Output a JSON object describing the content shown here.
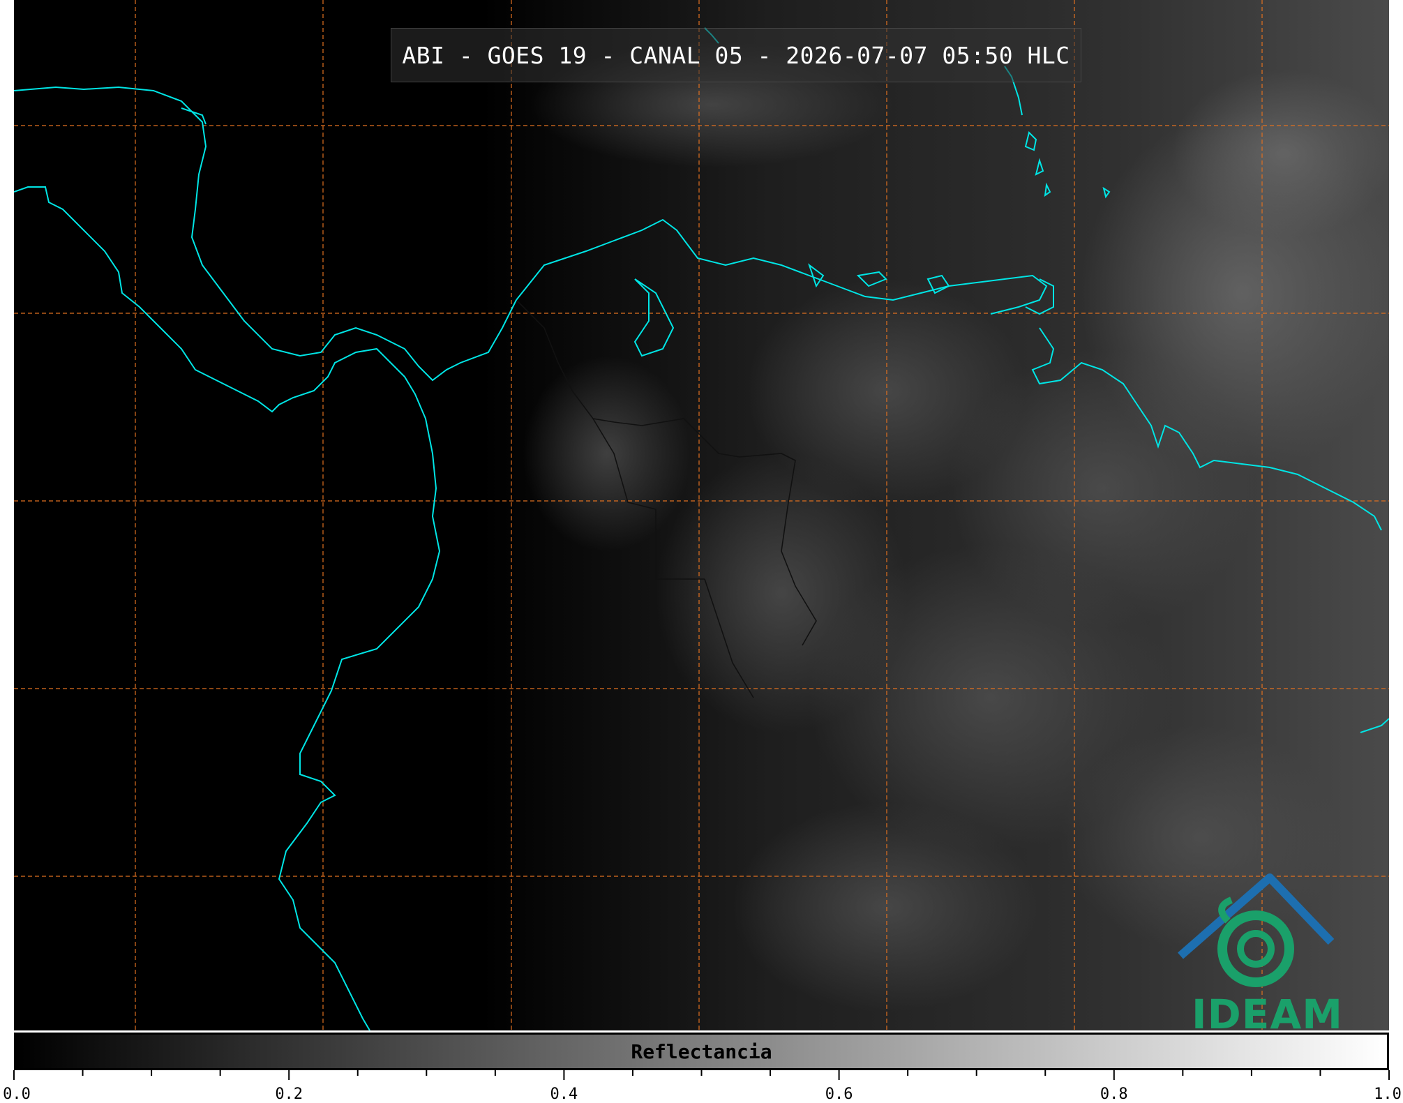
{
  "title": "ABI - GOES 19 - CANAL 05 - 2026-07-07 05:50 HLC",
  "logo": {
    "text": "IDEAM",
    "color": "#1aa06a"
  },
  "colorbar": {
    "label": "Reflectancia",
    "colors": [
      "#000000",
      "#ffffff"
    ],
    "ticks": [
      "0.0",
      "0.2",
      "0.4",
      "0.6",
      "0.8",
      "1.0"
    ],
    "range": [
      0.0,
      1.0
    ]
  },
  "map": {
    "coastline_color": "#00e5e5",
    "border_color": "#111111",
    "gridline_color": "#e07020",
    "gridline_style": "dashed"
  }
}
